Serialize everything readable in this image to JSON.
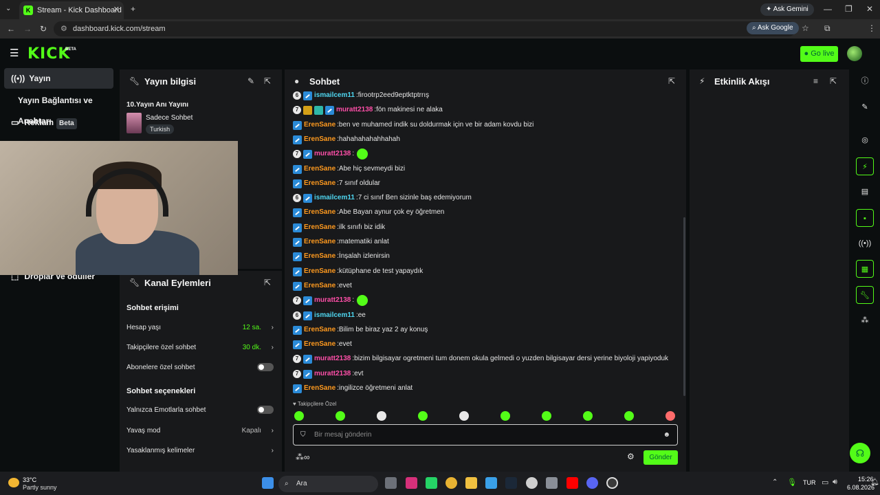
{
  "browser": {
    "tab_title": "Stream - Kick Dashboard",
    "url": "dashboard.kick.com/stream",
    "ask_gemini": "Ask Gemini",
    "ask_google": "Ask Google",
    "profile_initial": "K"
  },
  "header": {
    "logo": "KICK",
    "logo_beta": "BETA",
    "go_live": "Go live"
  },
  "sidebar": {
    "items": [
      {
        "label": "Yayın",
        "active": true
      },
      {
        "label": "Yayın Bağlantısı ve Anahtarı"
      },
      {
        "label": "Reklam",
        "badge": "Beta"
      },
      {
        "label": "Droplar ve ödüller"
      }
    ]
  },
  "stream_info": {
    "title": "Yayın bilgisi",
    "stream_title": "10.Yayın Anı Yayını",
    "category": "Sadece Sohbet",
    "language": "Turkish"
  },
  "channel_actions": {
    "title": "Kanal Eylemleri",
    "chat_access_header": "Sohbet erişimi",
    "account_age_label": "Hesap yaşı",
    "account_age_value": "12 sa.",
    "followers_only_label": "Takipçilere özel sohbet",
    "followers_only_value": "30 dk.",
    "subscribers_only_label": "Abonelere özel sohbet",
    "chat_options_header": "Sohbet seçenekleri",
    "emote_only_label": "Yalnızca Emotlarla sohbet",
    "slow_mode_label": "Yavaş mod",
    "slow_mode_value": "Kapalı",
    "banned_words_label": "Yasaklanmış kelimeler"
  },
  "chat": {
    "title": "Sohbet",
    "messages": [
      {
        "badge": "6",
        "user": "ismailcem11",
        "color": "#4fd6f0",
        "text": "firootrp2eed9eptktptrrış"
      },
      {
        "badge": "7",
        "user": "muratt2138",
        "color": "#ff4fa8",
        "text": "fön makinesi ne alaka"
      },
      {
        "badge": "",
        "user": "ErenSane",
        "color": "#ff9a1f",
        "text": "ben ve muhamed indik su doldurmak için ve bir adam kovdu bizi"
      },
      {
        "badge": "",
        "user": "ErenSane",
        "color": "#ff9a1f",
        "text": "hahahahahahhahah"
      },
      {
        "badge": "7",
        "user": "muratt2138",
        "color": "#ff4fa8",
        "text": ""
      },
      {
        "badge": "",
        "user": "ErenSane",
        "color": "#ff9a1f",
        "text": "Abe hiç sevmeydi bizi"
      },
      {
        "badge": "",
        "user": "ErenSane",
        "color": "#ff9a1f",
        "text": "7 sınıf oldular"
      },
      {
        "badge": "6",
        "user": "ismailcem11",
        "color": "#4fd6f0",
        "text": "7 ci sınıf Ben sizinle baş edemiyorum"
      },
      {
        "badge": "",
        "user": "ErenSane",
        "color": "#ff9a1f",
        "text": "Abe Bayan aynur çok ey öğretmen"
      },
      {
        "badge": "",
        "user": "ErenSane",
        "color": "#ff9a1f",
        "text": "ilk sınıfı biz idik"
      },
      {
        "badge": "",
        "user": "ErenSane",
        "color": "#ff9a1f",
        "text": "matematiki anlat"
      },
      {
        "badge": "",
        "user": "ErenSane",
        "color": "#ff9a1f",
        "text": "İnşalah izlenirsin"
      },
      {
        "badge": "",
        "user": "ErenSane",
        "color": "#ff9a1f",
        "text": "kütüphane de test yapaydık"
      },
      {
        "badge": "",
        "user": "ErenSane",
        "color": "#ff9a1f",
        "text": "evet"
      },
      {
        "badge": "7",
        "user": "muratt2138",
        "color": "#ff4fa8",
        "text": ""
      },
      {
        "badge": "6",
        "user": "ismailcem11",
        "color": "#4fd6f0",
        "text": "ee"
      },
      {
        "badge": "",
        "user": "ErenSane",
        "color": "#ff9a1f",
        "text": "Bilim be biraz yaz 2 ay konuş"
      },
      {
        "badge": "",
        "user": "ErenSane",
        "color": "#ff9a1f",
        "text": "evet"
      },
      {
        "badge": "7",
        "user": "muratt2138",
        "color": "#ff4fa8",
        "text": "bizim bilgisayar ogretmeni tum donem okula gelmedi o yuzden bilgisayar dersi yerine biyoloji yapiyoduk"
      },
      {
        "badge": "7",
        "user": "muratt2138",
        "color": "#ff4fa8",
        "text": "evt"
      },
      {
        "badge": "",
        "user": "ErenSane",
        "color": "#ff9a1f",
        "text": "ingilizce öğretmeni anlat"
      }
    ],
    "followers_only_note": "Takipçilere Özel",
    "input_placeholder": "Bir mesaj gönderin",
    "send_label": "Gönder"
  },
  "activity": {
    "title": "Etkinlik Akışı"
  },
  "taskbar": {
    "weather_temp": "33°C",
    "weather_desc": "Partly sunny",
    "search_label": "Ara",
    "lang": "TUR",
    "time": "15:26",
    "date": "6.08.2026"
  },
  "colors": {
    "accent": "#53fc18",
    "panel_bg": "#18191b",
    "page_bg": "#0b0e0f"
  }
}
